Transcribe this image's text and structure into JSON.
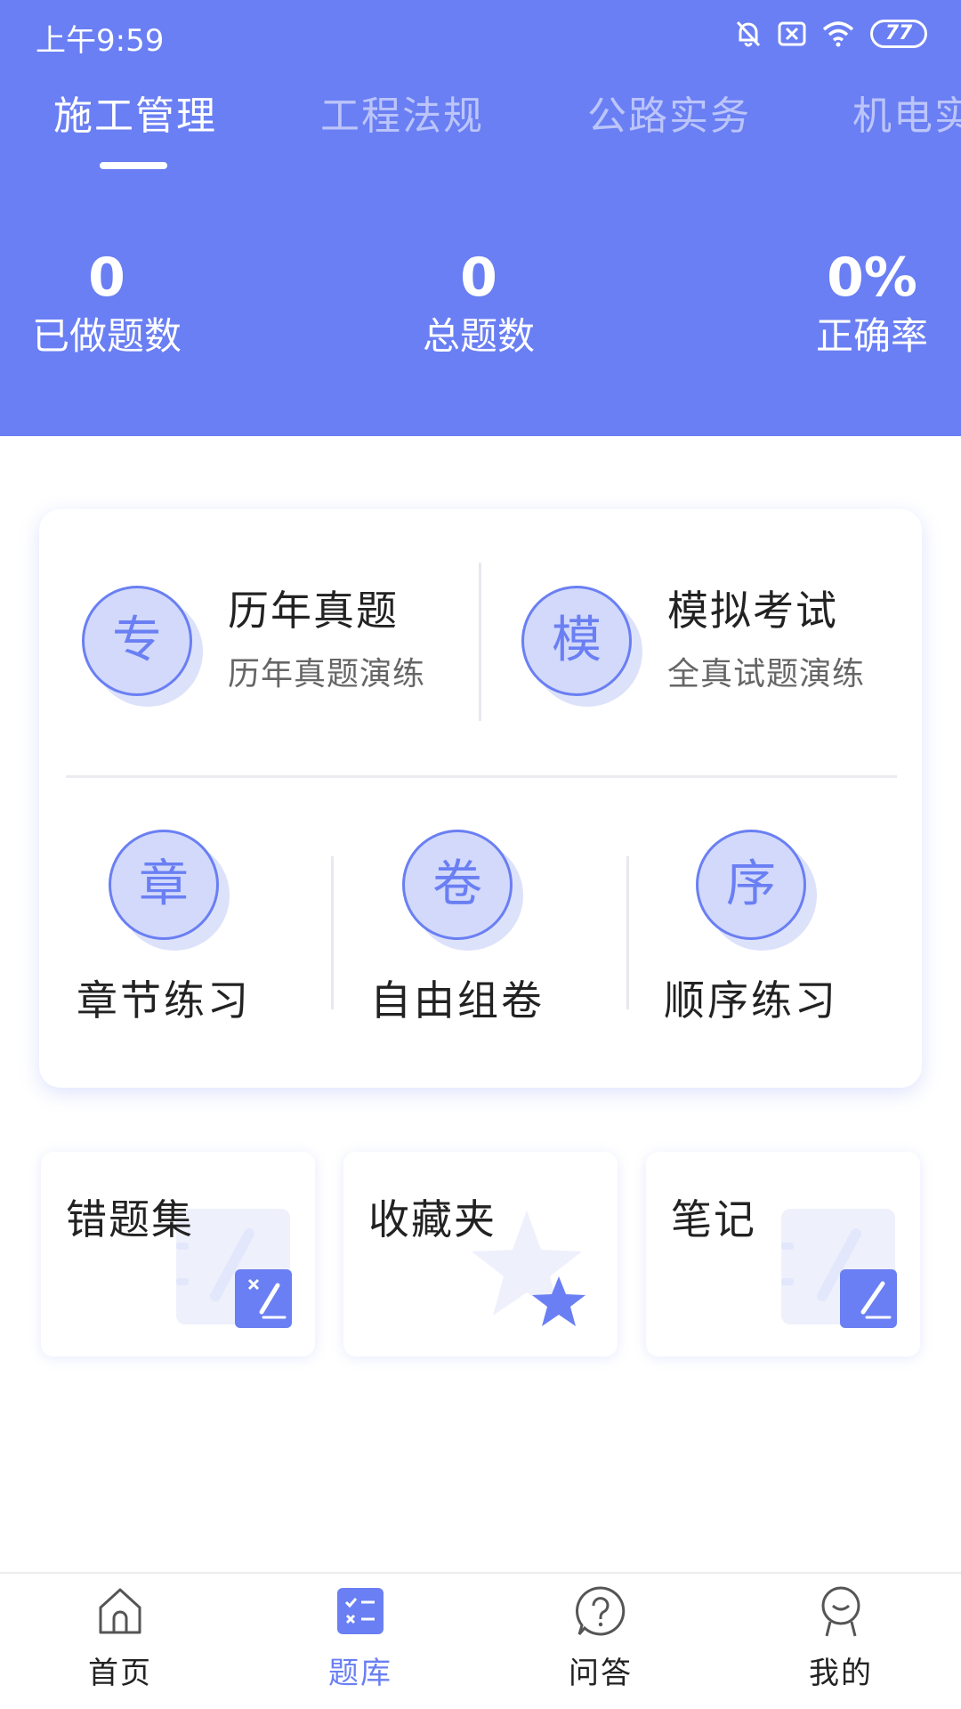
{
  "status_bar": {
    "time": "上午9:59",
    "battery": "77"
  },
  "tabs": [
    {
      "label": "施工管理",
      "active": true
    },
    {
      "label": "工程法规",
      "active": false
    },
    {
      "label": "公路实务",
      "active": false
    },
    {
      "label": "机电实",
      "active": false
    }
  ],
  "stats": [
    {
      "value": "0",
      "label": "已做题数"
    },
    {
      "value": "0",
      "label": "总题数"
    },
    {
      "value": "0%",
      "label": "正确率"
    }
  ],
  "features_top": [
    {
      "badge": "专",
      "title": "历年真题",
      "subtitle": "历年真题演练"
    },
    {
      "badge": "模",
      "title": "模拟考试",
      "subtitle": "全真试题演练"
    }
  ],
  "features_bottom": [
    {
      "badge": "章",
      "label": "章节练习"
    },
    {
      "badge": "卷",
      "label": "自由组卷"
    },
    {
      "badge": "序",
      "label": "顺序练习"
    }
  ],
  "mini_cards": [
    {
      "title": "错题集",
      "icon": "edit-note-icon"
    },
    {
      "title": "收藏夹",
      "icon": "star-icon"
    },
    {
      "title": "笔记",
      "icon": "pen-note-icon"
    }
  ],
  "bottom_nav": [
    {
      "label": "首页",
      "icon": "home-icon",
      "active": false
    },
    {
      "label": "题库",
      "icon": "question-bank-icon",
      "active": true
    },
    {
      "label": "问答",
      "icon": "question-icon",
      "active": false
    },
    {
      "label": "我的",
      "icon": "profile-icon",
      "active": false
    }
  ],
  "colors": {
    "primary": "#6a7ff3",
    "badge_bg": "#d2d9fb",
    "light_shape": "#eef0fc"
  }
}
